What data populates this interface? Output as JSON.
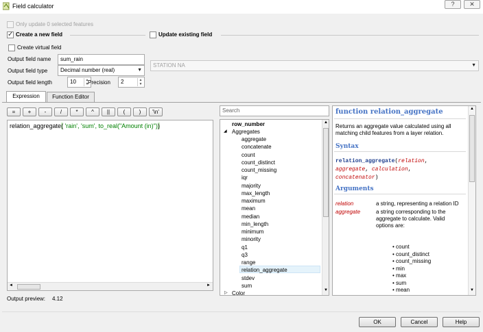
{
  "window": {
    "title": "Field calculator",
    "help_btn": "?",
    "close_btn": "✕"
  },
  "options": {
    "only_update": "Only update 0 selected features",
    "create_new": "Create a new field",
    "update_existing": "Update existing field",
    "create_virtual": "Create virtual field"
  },
  "form": {
    "name_label": "Output field name",
    "name_value": "sum_rain",
    "type_label": "Output field type",
    "type_value": "Decimal number (real)",
    "length_label": "Output field length",
    "length_value": "10",
    "precision_label": "Precision",
    "precision_value": "2",
    "existing_value": "STATION NA"
  },
  "tabs": {
    "expression": "Expression",
    "function_editor": "Function Editor"
  },
  "operators": [
    "=",
    "+",
    "-",
    "/",
    "*",
    "^",
    "||",
    "(",
    ")",
    "'\\n'"
  ],
  "expression": {
    "func": "relation_aggregate",
    "open": "(",
    "args": " 'rain', 'sum', ",
    "inner": " to_real(\"Amount (in)\")",
    "close": ")"
  },
  "preview": {
    "label": "Output preview:",
    "value": "4.12"
  },
  "search": {
    "placeholder": "Search"
  },
  "tree": {
    "row_number": "row_number",
    "aggregates": "Aggregates",
    "items": [
      "aggregate",
      "concatenate",
      "count",
      "count_distinct",
      "count_missing",
      "iqr",
      "majority",
      "max_length",
      "maximum",
      "mean",
      "median",
      "min_length",
      "minimum",
      "minority",
      "q1",
      "q3",
      "range",
      "relation_aggregate",
      "stdev",
      "sum"
    ],
    "color": "Color",
    "selected": "relation_aggregate"
  },
  "help": {
    "title": "function relation_aggregate",
    "description": "Returns an aggregate value calculated using all matching child features from a layer relation.",
    "syntax_h": "Syntax",
    "syntax_fn": "relation_aggregate",
    "syntax_open": "(",
    "syntax_p1": "relation",
    "syntax_p2": "aggregate",
    "syntax_p3": "calculation",
    "syntax_p4": "concatenator",
    "syntax_close": ")",
    "args_h": "Arguments",
    "arg1_name": "relation",
    "arg1_desc": "a string, representing a relation ID",
    "arg2_name": "aggregate",
    "arg2_desc": "a string corresponding to the aggregate to calculate. Valid options are:",
    "bullets": [
      "count",
      "count_distinct",
      "count_missing",
      "min",
      "max",
      "sum",
      "mean"
    ]
  },
  "buttons": {
    "ok": "OK",
    "cancel": "Cancel",
    "help": "Help"
  },
  "colors": {
    "func": "#000000",
    "string": "#008000",
    "accent": "#4472c4",
    "param": "#c00000",
    "selection": "#e5f3fb"
  }
}
